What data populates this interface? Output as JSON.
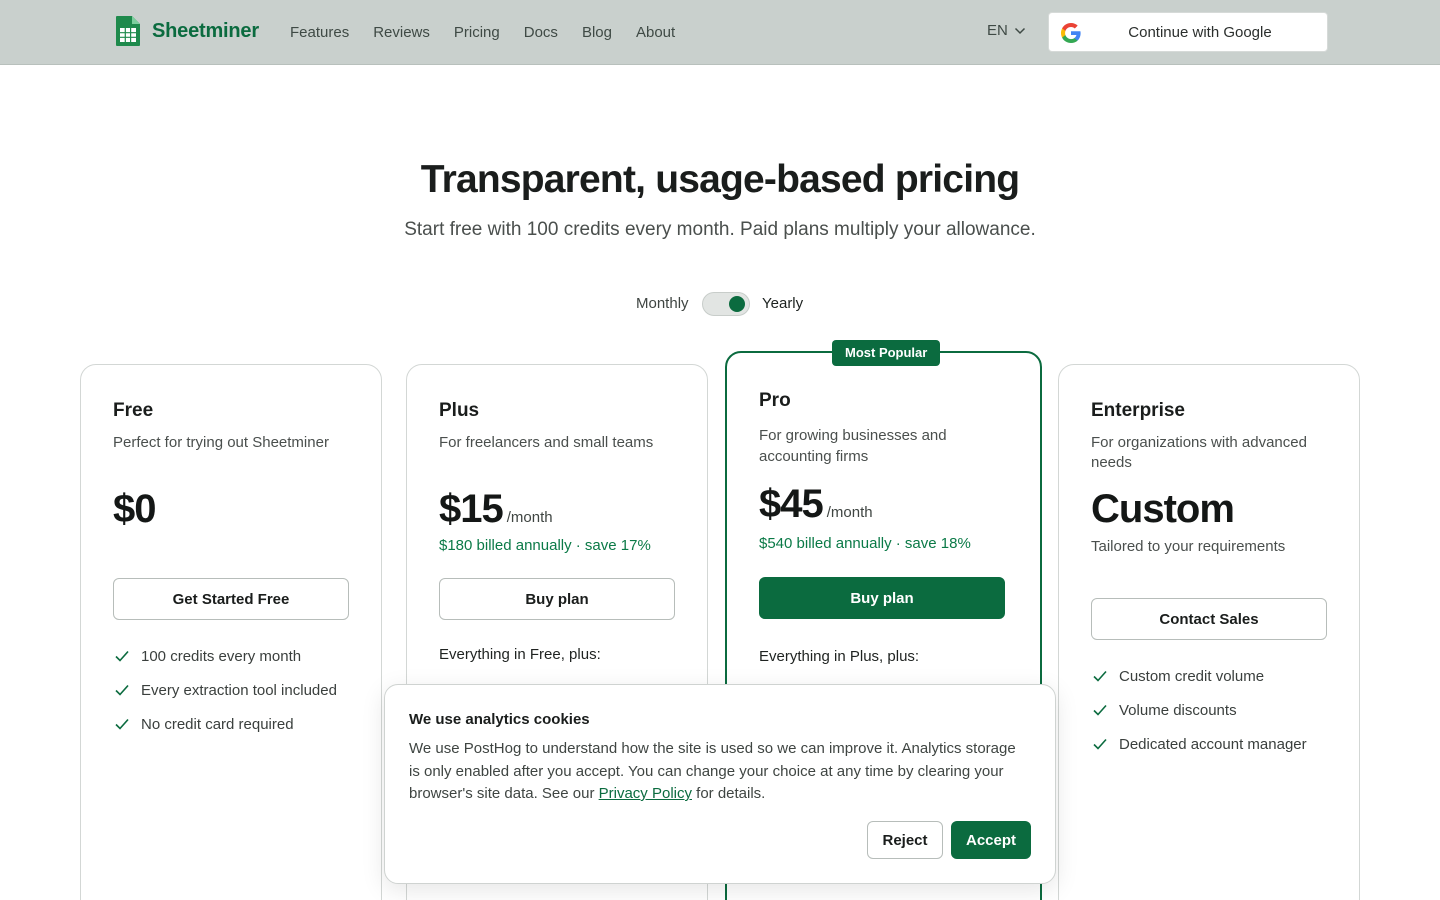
{
  "header": {
    "brand": "Sheetminer",
    "nav": [
      "Features",
      "Reviews",
      "Pricing",
      "Docs",
      "Blog",
      "About"
    ],
    "language": "EN",
    "google_button": "Continue with Google"
  },
  "hero": {
    "title": "Transparent, usage-based pricing",
    "subtitle": "Start free with 100 credits every month. Paid plans multiply your allowance."
  },
  "billing_toggle": {
    "monthly_label": "Monthly",
    "yearly_label": "Yearly",
    "selected": "Yearly"
  },
  "plans": {
    "free": {
      "name": "Free",
      "description": "Perfect for trying out Sheetminer",
      "price": "$0",
      "cta": "Get Started Free",
      "features": [
        "100 credits every month",
        "Every extraction tool included",
        "No credit card required"
      ]
    },
    "plus": {
      "name": "Plus",
      "description": "For freelancers and small teams",
      "price": "$15",
      "period": "/month",
      "billed": "$180 billed annually · save 17%",
      "cta": "Buy plan",
      "includes_label": "Everything in Free, plus:"
    },
    "pro": {
      "badge": "Most Popular",
      "name": "Pro",
      "description": "For growing businesses and accounting firms",
      "price": "$45",
      "period": "/month",
      "billed": "$540 billed annually · save 18%",
      "cta": "Buy plan",
      "includes_label": "Everything in Plus, plus:"
    },
    "enterprise": {
      "name": "Enterprise",
      "description": "For organizations with advanced needs",
      "price": "Custom",
      "tagline": "Tailored to your requirements",
      "cta": "Contact Sales",
      "features": [
        "Custom credit volume",
        "Volume discounts",
        "Dedicated account manager"
      ]
    }
  },
  "cookie_banner": {
    "title": "We use analytics cookies",
    "body_before_link": "We use PostHog to understand how the site is used so we can improve it. Analytics storage is only enabled after you accept. You can change your choice at any time by clearing your browser's site data. See our ",
    "link": "Privacy Policy",
    "body_after_link": " for details.",
    "reject": "Reject",
    "accept": "Accept"
  },
  "colors": {
    "brand": "#0b6b3f",
    "header_bg": "#c9d0cd",
    "savings_text": "#0b7a47"
  }
}
